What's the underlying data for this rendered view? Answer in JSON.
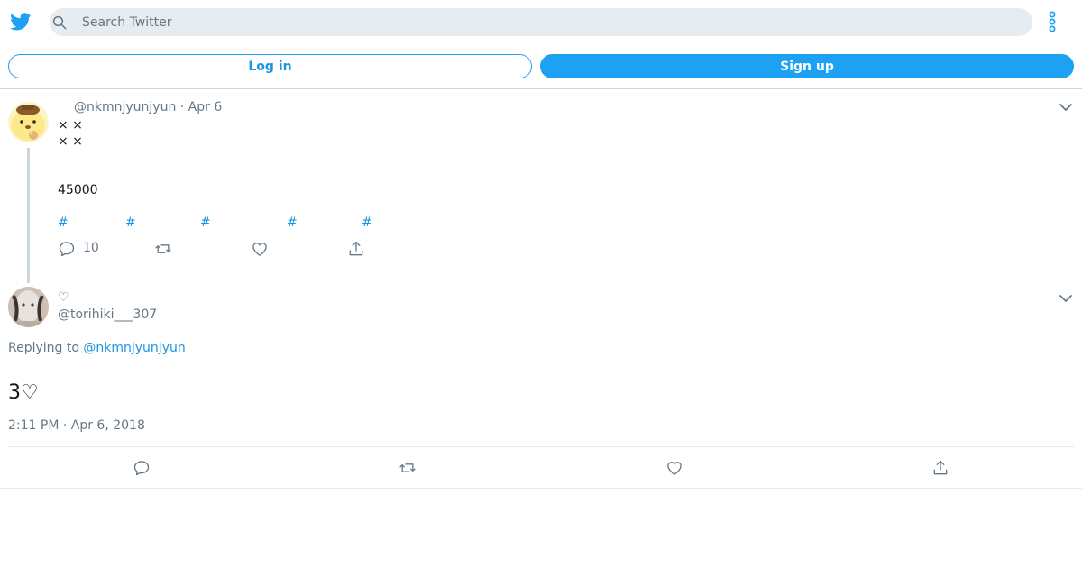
{
  "header": {
    "search_placeholder": "Search Twitter",
    "login_label": "Log in",
    "signup_label": "Sign up"
  },
  "colors": {
    "accent": "#1da1f2",
    "link": "#1b95e0",
    "muted": "#657786",
    "search_bg": "#e6ecf0"
  },
  "tweet": {
    "handle_date": "@nkmnjyunjyun · Apr 6",
    "lines": [
      "× ×",
      "× ×",
      "45000"
    ],
    "hashtags": [
      "#",
      "#",
      "#",
      "#",
      "#"
    ],
    "reply_count": "10",
    "icons": [
      "reply-icon",
      "retweet-icon",
      "like-icon",
      "share-icon"
    ]
  },
  "reply": {
    "name": "♡",
    "handle": "@torihiki___307",
    "replying_prefix": "Replying to",
    "replying_mention": "@nkmnjyunjyun",
    "body": "3♡",
    "timestamp": "2:11 PM · Apr 6, 2018"
  }
}
